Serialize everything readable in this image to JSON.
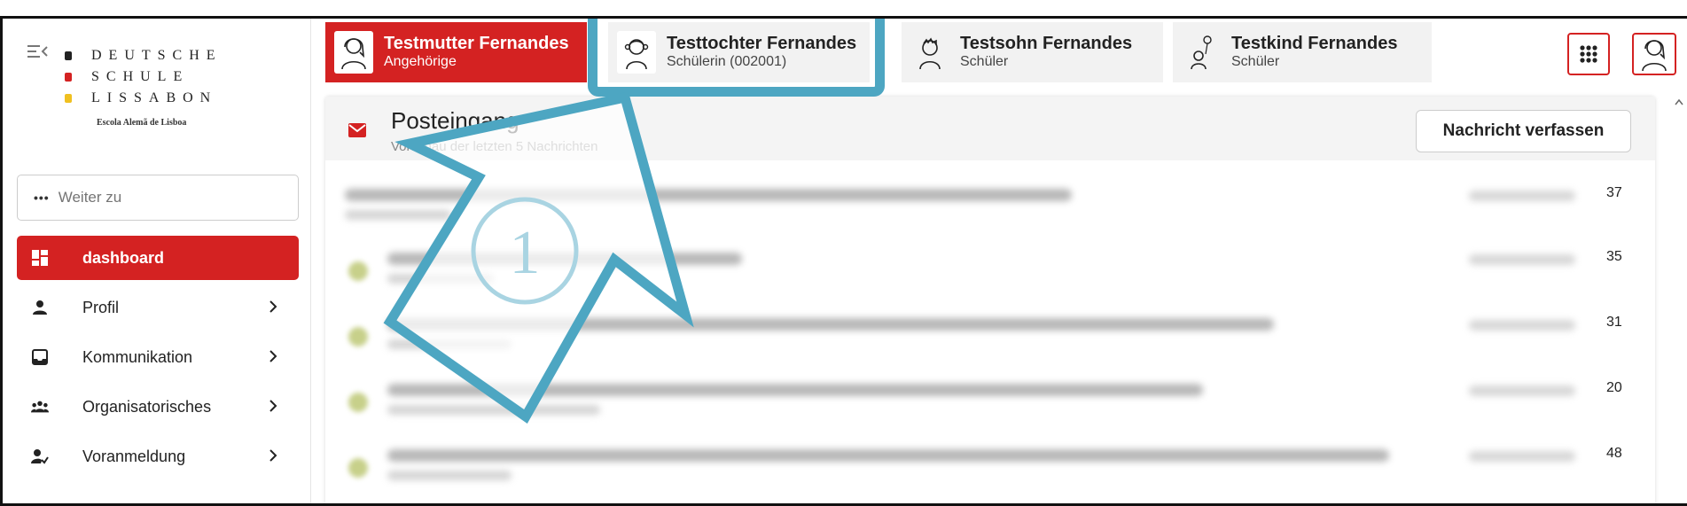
{
  "sidebar": {
    "logo": {
      "line1": "DEUTSCHE",
      "line2": "SCHULE",
      "line3": "LISSABON",
      "subtitle": "Escola Alemã de Lisboa",
      "dot_colors": [
        "#222222",
        "#d42222",
        "#f0c020"
      ]
    },
    "search": {
      "placeholder": "Weiter zu",
      "icon": "ellipsis-icon"
    },
    "items": [
      {
        "label": "dashboard",
        "icon": "dashboard-icon",
        "active": true
      },
      {
        "label": "Profil",
        "icon": "person-icon",
        "active": false
      },
      {
        "label": "Kommunikation",
        "icon": "inbox-icon",
        "active": false
      },
      {
        "label": "Organisatorisches",
        "icon": "group-icon",
        "active": false
      },
      {
        "label": "Voranmeldung",
        "icon": "person-check-icon",
        "active": false
      }
    ]
  },
  "tabs": [
    {
      "name": "Testmutter Fernandes",
      "role": "Angehörige",
      "icon": "mother-avatar-icon",
      "active": true
    },
    {
      "name": "Testtochter Fernandes",
      "role": "Schülerin (002001)",
      "icon": "daughter-avatar-icon",
      "active": false
    },
    {
      "name": "Testsohn Fernandes",
      "role": "Schüler",
      "icon": "son-avatar-icon",
      "active": false
    },
    {
      "name": "Testkind Fernandes",
      "role": "Schüler",
      "icon": "child-avatar-icon",
      "active": false
    }
  ],
  "header_buttons": {
    "apps_icon": "apps-grid-icon",
    "profile_icon": "profile-avatar-icon"
  },
  "inbox": {
    "title": "Posteingang",
    "subtitle": "Vorschau der letzten 5 Nachrichten",
    "compose_label": "Nachricht verfassen",
    "messages": [
      {
        "time_suffix": "37"
      },
      {
        "time_suffix": "35"
      },
      {
        "time_suffix": "31"
      },
      {
        "time_suffix": "20"
      },
      {
        "time_suffix": "48"
      }
    ]
  },
  "annotation": {
    "step": "1",
    "color": "#4da6c2"
  },
  "colors": {
    "accent": "#d42222",
    "annotation": "#4da6c2"
  }
}
